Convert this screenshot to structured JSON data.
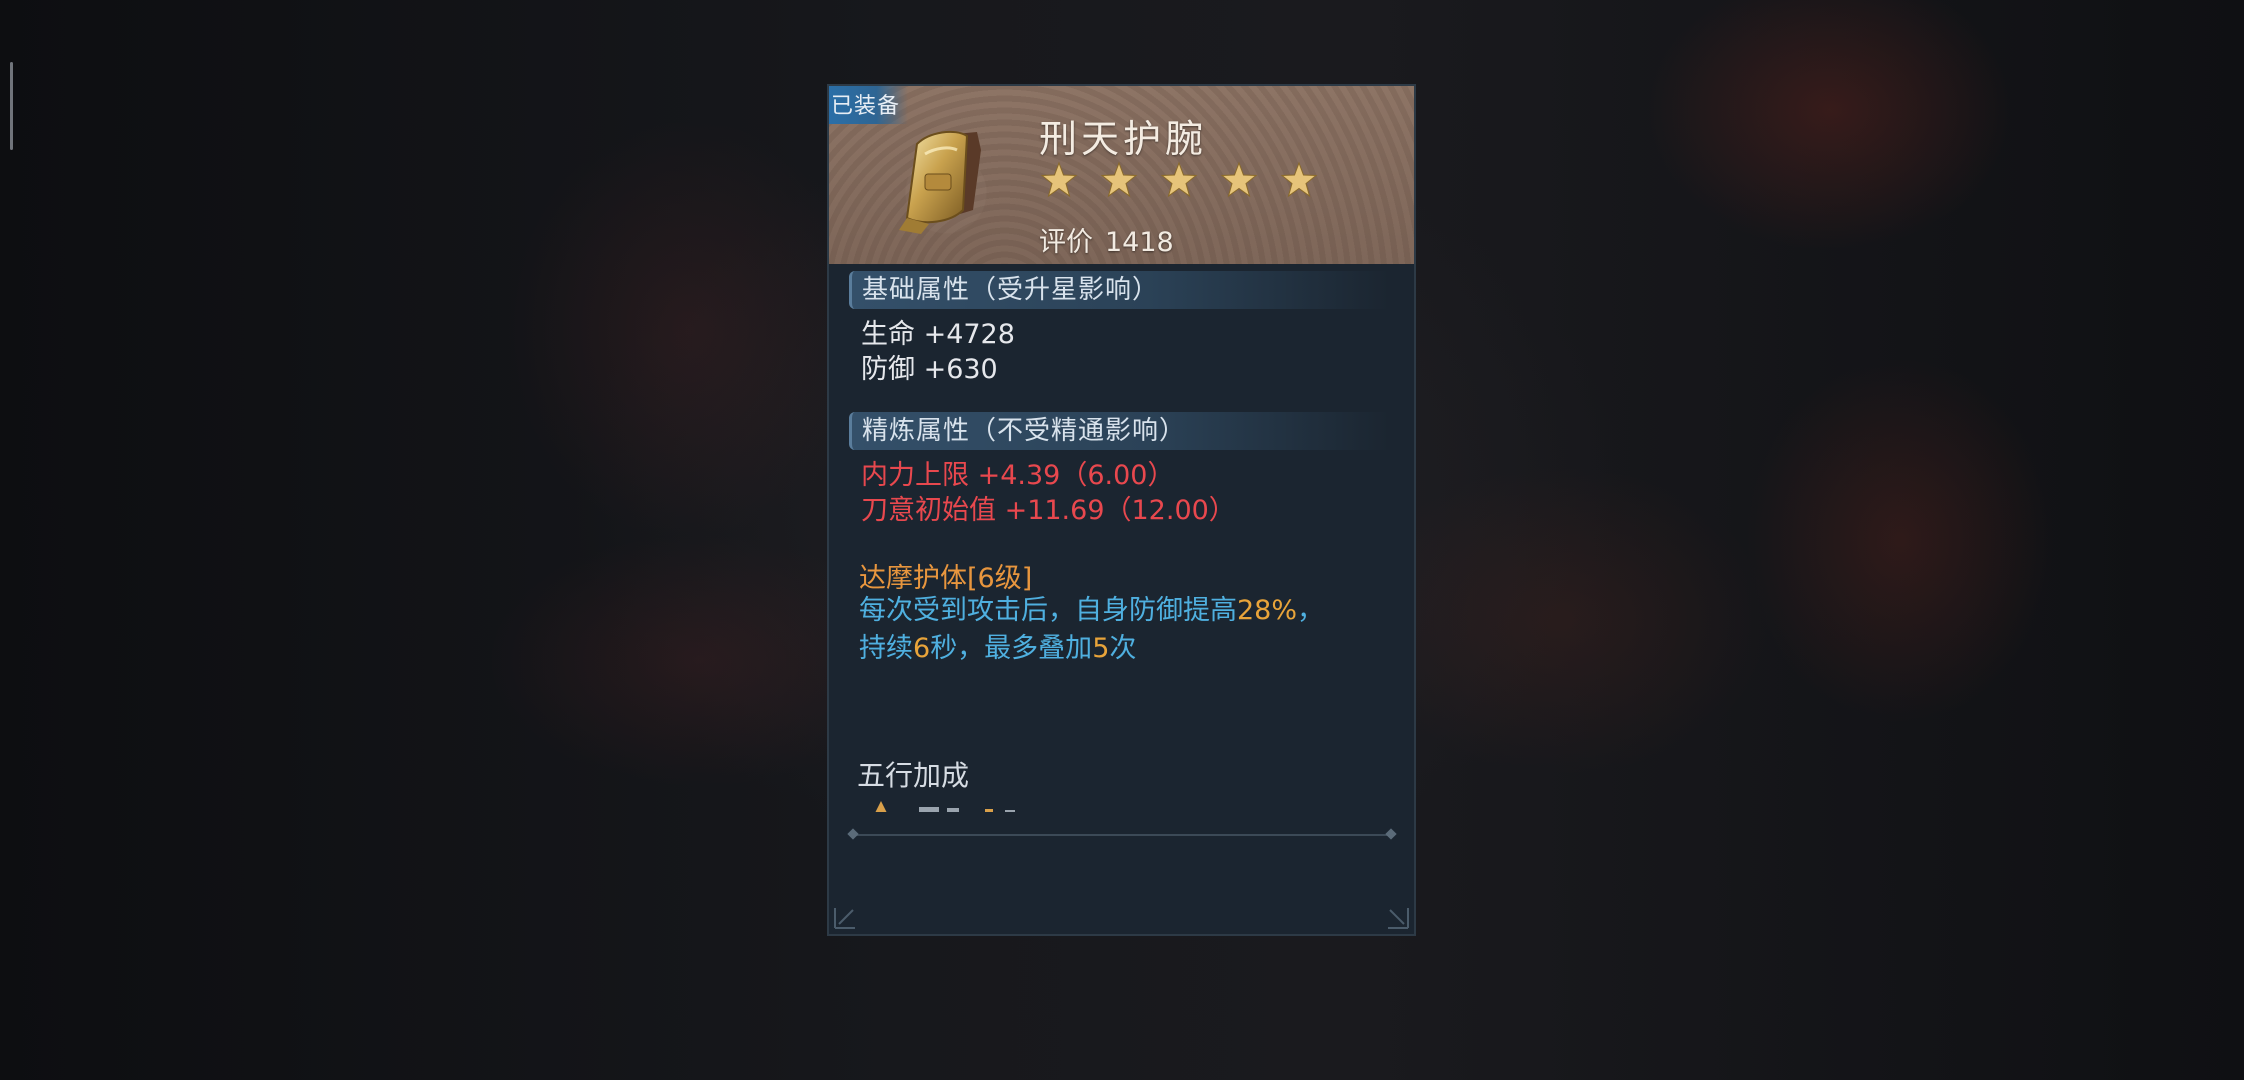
{
  "item": {
    "equipped_badge": "已装备",
    "name": "刑天护腕",
    "stars": 5,
    "score_label": "评价",
    "score_value": "1418"
  },
  "base_attributes": {
    "header": "基础属性（受升星影响）",
    "stats": [
      "生命 +4728",
      "防御 +630"
    ]
  },
  "refine_attributes": {
    "header": "精炼属性（不受精通影响）",
    "stats": [
      "内力上限 +4.39（6.00）",
      "刀意初始值 +11.69（12.00）"
    ]
  },
  "skill": {
    "title": "达摩护体[6级]",
    "line1_a": "每次受到攻击后，自身防御提高",
    "line1_hl": "28%",
    "line1_b": "，",
    "line2_a": "持续",
    "line2_hl1": "6",
    "line2_b": "秒，最多叠加",
    "line2_hl2": "5",
    "line2_c": "次"
  },
  "wuxing": {
    "title": "五行加成"
  },
  "colors": {
    "panel_bg": "#1b2530",
    "refine_red": "#e8484e",
    "skill_title_orange": "#e8963e",
    "skill_desc_blue": "#4fb0e0",
    "highlight_gold": "#e8a43a"
  },
  "icons": [
    "bracer-item-icon",
    "star-icon"
  ]
}
